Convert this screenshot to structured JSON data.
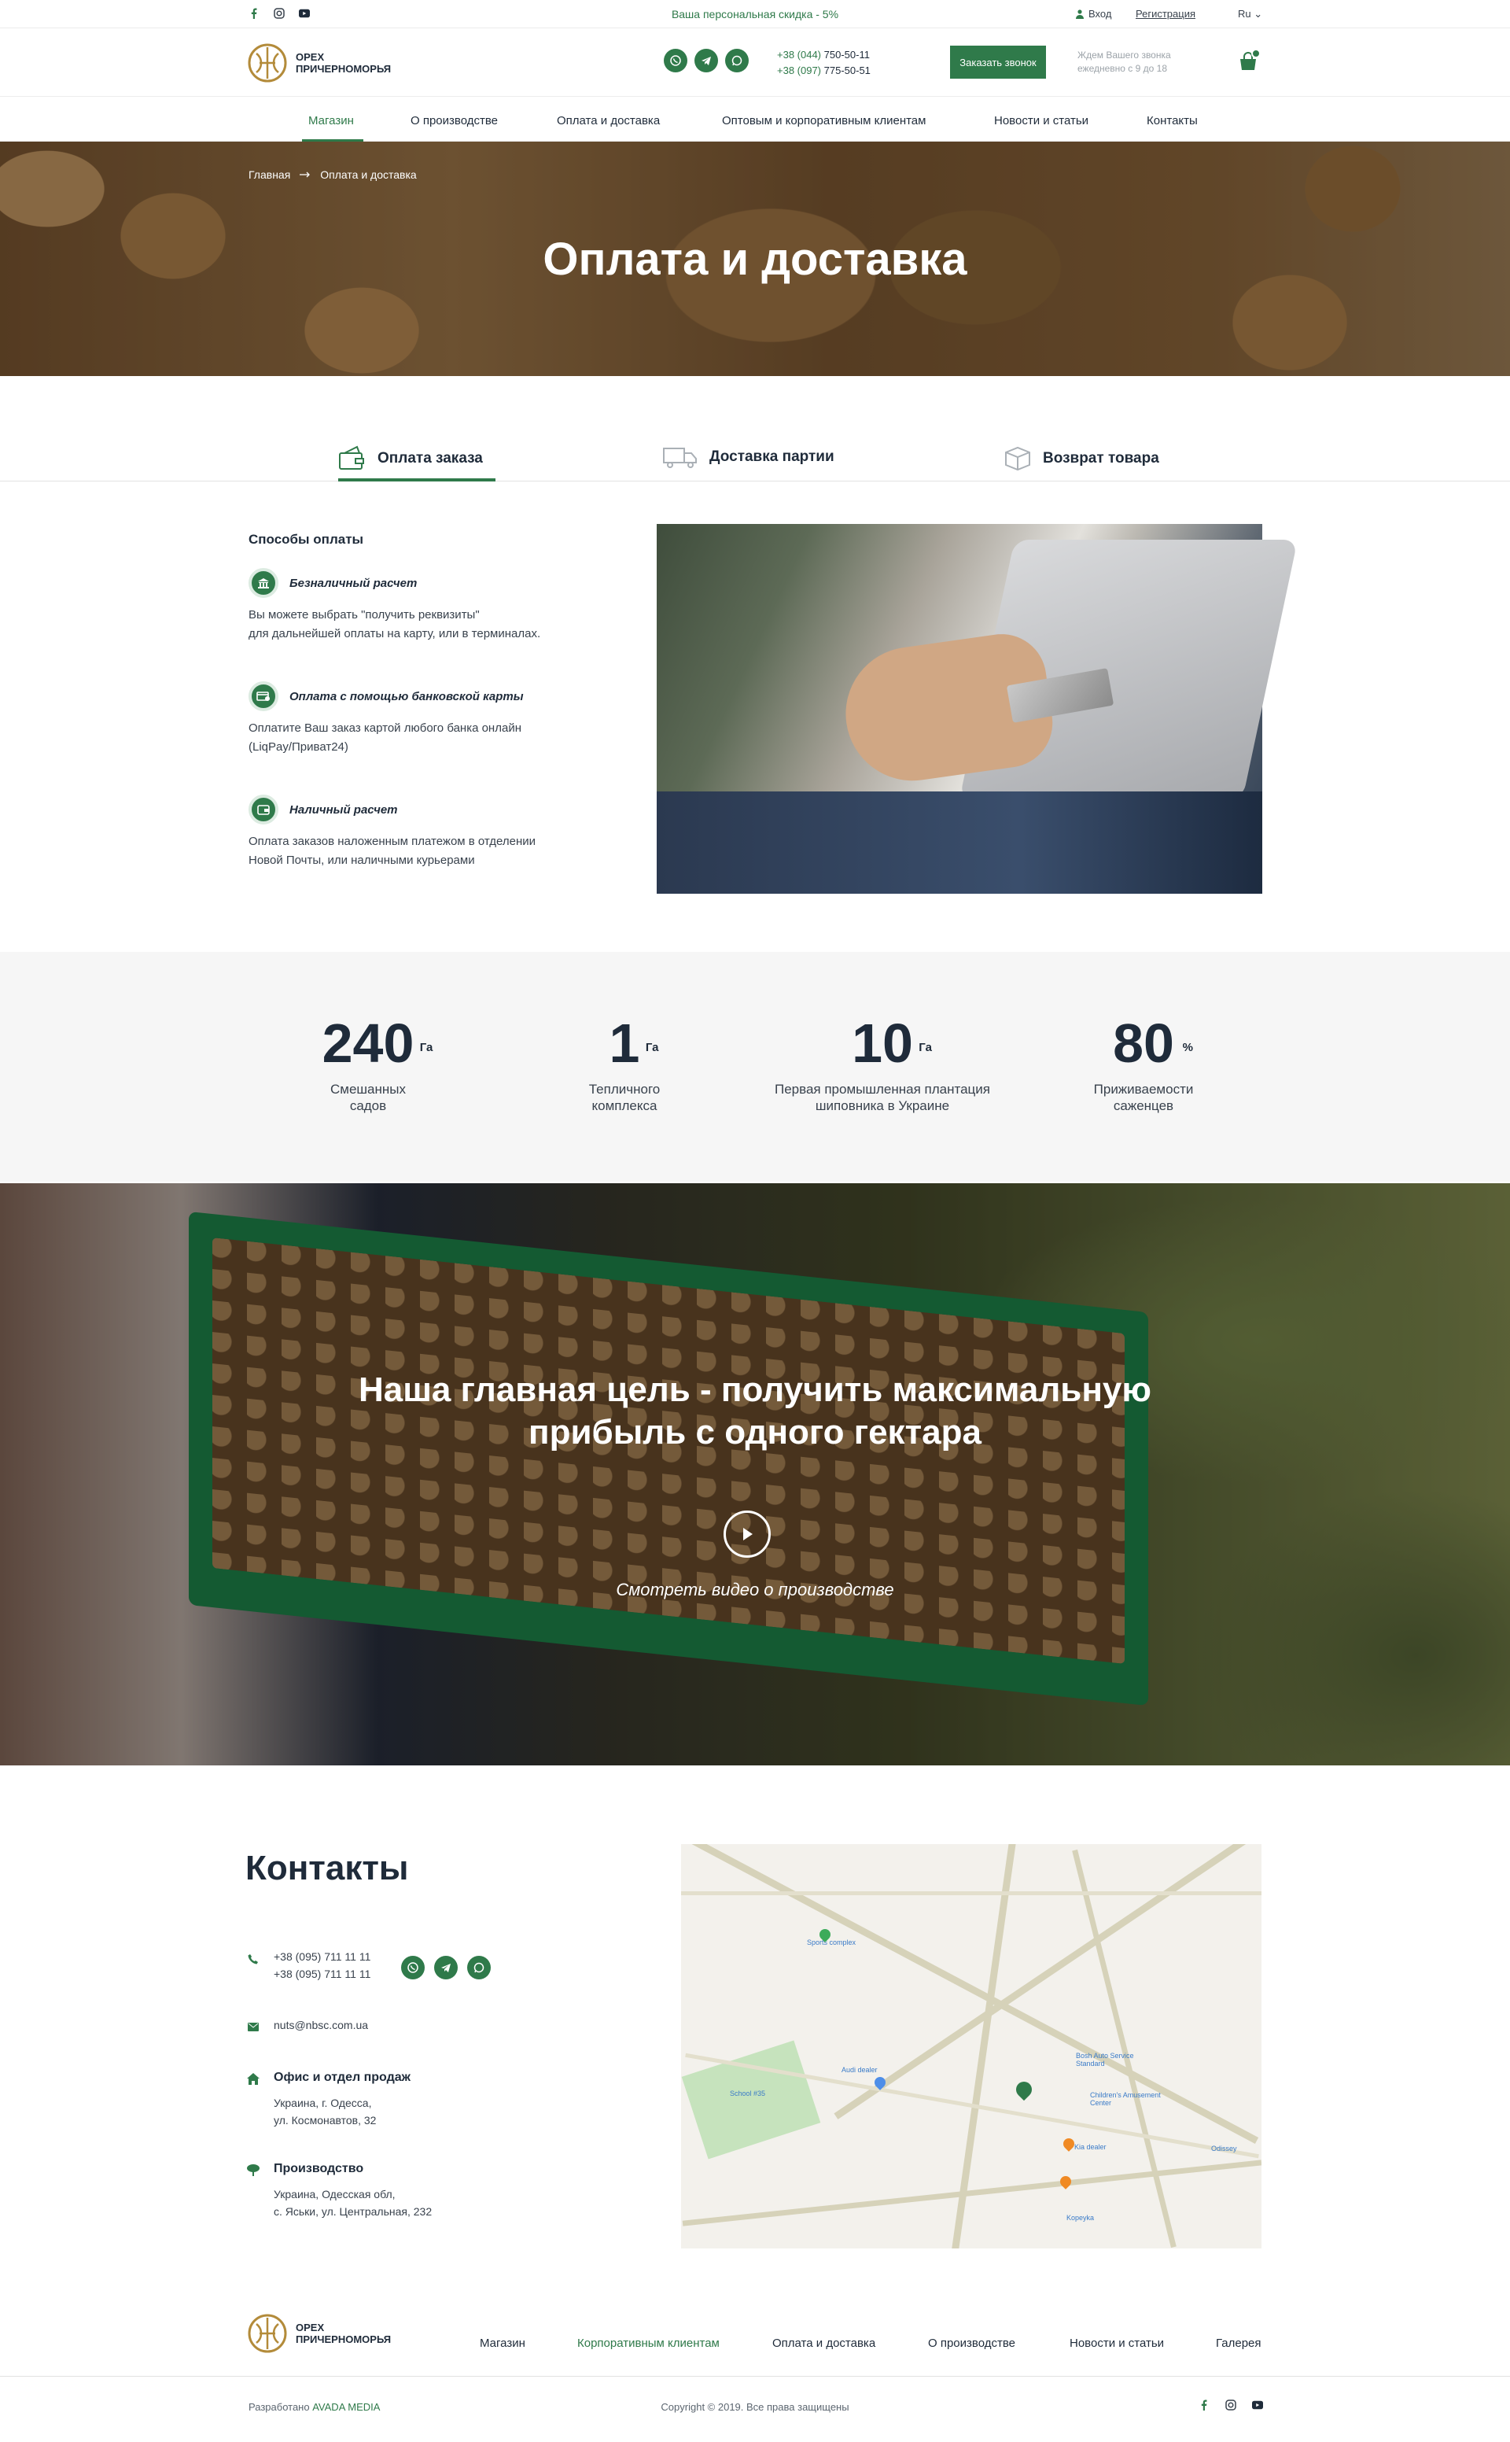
{
  "topbar": {
    "promo": "Ваша персональная скидка - 5%",
    "login": "Вход",
    "register": "Регистрация",
    "lang": "Ru ⌄",
    "social_icons": [
      "facebook-icon",
      "instagram-icon",
      "youtube-icon"
    ]
  },
  "brand": {
    "line1": "ОРЕХ",
    "line2": "ПРИЧЕРНОМОРЬЯ"
  },
  "header": {
    "phone1_code": "+38 (044)",
    "phone1_num": "750-50-11",
    "phone2_code": "+38 (097)",
    "phone2_num": "775-50-51",
    "call_button": "Заказать звонок",
    "call_note": "Ждем Вашего звонка ежедневно с 9 до 18"
  },
  "nav": {
    "items": [
      "Магазин",
      "О производстве",
      "Оплата и доставка",
      "Оптовым и корпоративным клиентам",
      "Новости и статьи",
      "Контакты"
    ],
    "active": "Магазин"
  },
  "hero": {
    "crumb_home": "Главная",
    "crumb_current": "Оплата и доставка",
    "title": "Оплата и доставка"
  },
  "tabs": [
    "Оплата заказа",
    "Доставка партии",
    "Возврат товара"
  ],
  "payment": {
    "title": "Способы оплаты",
    "methods": [
      {
        "name": "Безналичный расчет",
        "text1": "Вы можете выбрать \"получить реквизиты\"",
        "text2": "для дальнейшей оплаты на карту, или в терминалах."
      },
      {
        "name": "Оплата с помощью банковской карты",
        "text1": "Оплатите Ваш заказ картой любого банка онлайн",
        "text2": "(LiqPay/Приват24)"
      },
      {
        "name": "Наличный расчет",
        "text1": "Оплата заказов наложенным платежом в отделении",
        "text2": "Новой Почты, или наличными курьерами"
      }
    ]
  },
  "stats": [
    {
      "value": "240",
      "unit": "Га",
      "label1": "Смешанных",
      "label2": "садов"
    },
    {
      "value": "1",
      "unit": "Га",
      "label1": "Тепличного",
      "label2": "комплекса"
    },
    {
      "value": "10",
      "unit": "Га",
      "label1": "Первая промышленная плантация",
      "label2": "шиповника в Украине"
    },
    {
      "value": "80",
      "unit": "%",
      "label1": "Приживаемости",
      "label2": "саженцев"
    }
  ],
  "video": {
    "title1": "Наша главная цель - получить максимальную",
    "title2": "прибыль с одного гектара",
    "caption": "Смотреть видео о производстве"
  },
  "contacts": {
    "title": "Контакты",
    "phone1": "+38 (095) 711 11 11",
    "phone2": "+38 (095) 711 11 11",
    "email": "nuts@nbsc.com.ua",
    "office_title": "Офис и отдел продаж",
    "office_addr1": "Украина, г. Одесса,",
    "office_addr2": "ул. Космонавтов, 32",
    "prod_title": "Производство",
    "prod_addr1": "Украина, Одесская обл,",
    "prod_addr2": "с. Яськи, ул. Центральная, 232",
    "map_labels": [
      "Sports complex",
      "Audi dealer",
      "School #35",
      "Bosh Auto Service Standard",
      "Children's Amusement Center",
      "Kia dealer",
      "Kopeyka",
      "Odissey"
    ]
  },
  "footer": {
    "nav": [
      "Магазин",
      "Корпоративным клиентам",
      "Оплата и доставка",
      "О производстве",
      "Новости и статьи",
      "Галерея"
    ],
    "dev_prefix": "Разработано",
    "dev_name": "AVADA MEDIA",
    "copyright": "Copyright © 2019. Все права защищены"
  },
  "colors": {
    "accent": "#2f7a4a",
    "text": "#1f2b3a",
    "muted": "#9ca3a9"
  }
}
